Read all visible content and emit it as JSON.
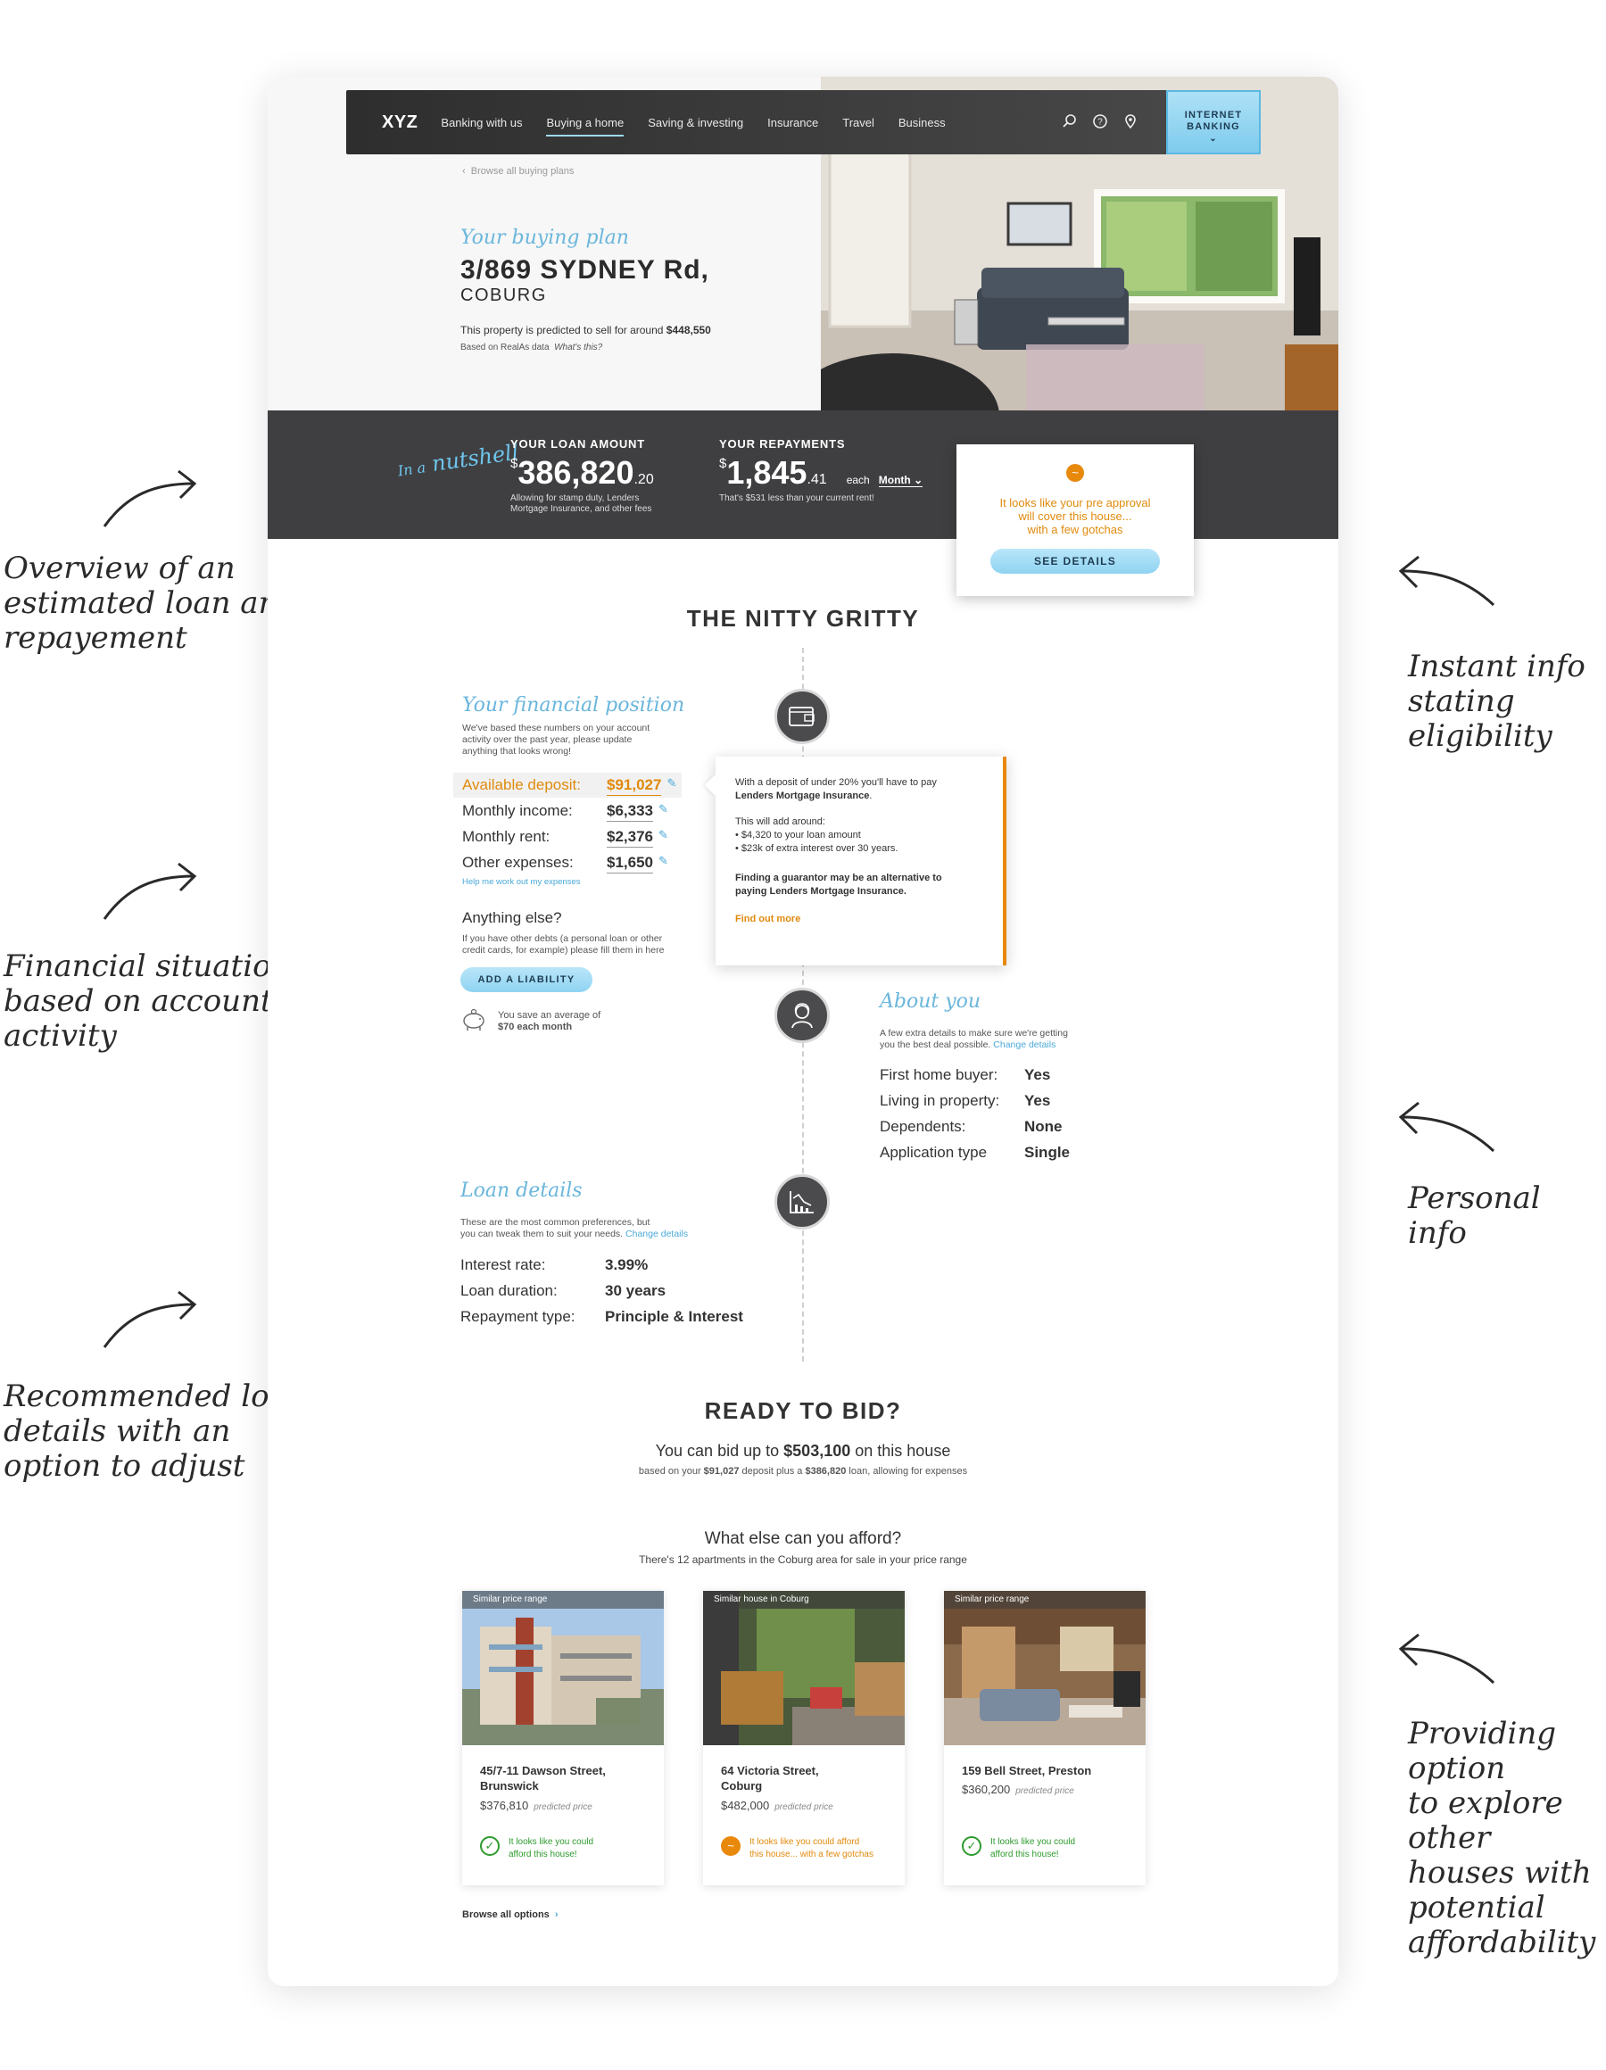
{
  "annotations": {
    "overview": [
      "Overview of an",
      "estimated loan and",
      "repayement"
    ],
    "eligibility": [
      "Instant info",
      "stating",
      "eligibility"
    ],
    "financial": [
      "Financial situation",
      "based on account",
      "activity"
    ],
    "personal": [
      "Personal info"
    ],
    "loan": [
      "Recommended loan",
      "details with an",
      "option to adjust"
    ],
    "explore": [
      "Providing option",
      "to explore other",
      "houses with",
      "potential",
      "affordability"
    ]
  },
  "nav": {
    "logo": "XYZ",
    "items": [
      "Banking with us",
      "Buying a home",
      "Saving & investing",
      "Insurance",
      "Travel",
      "Business"
    ],
    "active_index": 1,
    "icons": [
      "search-icon",
      "help-icon",
      "location-pin-icon"
    ],
    "internet_banking": [
      "INTERNET",
      "BANKING"
    ]
  },
  "hero": {
    "breadcrumb": "Browse all buying plans",
    "kicker": "Your buying plan",
    "title": "3/869 SYDNEY Rd,",
    "suburb": "COBURG",
    "predicted_text": "This property is predicted to sell for around",
    "predicted_value": "$448,550",
    "based_on": "Based on RealAs data",
    "whats_this": "What's this?"
  },
  "nutshell": {
    "label_line1": "In a",
    "label_line2": "nutshell",
    "loan": {
      "heading": "YOUR LOAN AMOUNT",
      "currency": "$",
      "whole": "386,820",
      "cents": ".20",
      "note": [
        "Allowing for stamp duty, Lenders",
        "Mortgage Insurance, and other fees"
      ]
    },
    "repay": {
      "heading": "YOUR REPAYMENTS",
      "currency": "$",
      "whole": "1,845",
      "cents": ".41",
      "each": "each",
      "period": "Month",
      "note": "That's $531 less than your current rent!"
    }
  },
  "preapproval": {
    "lines": [
      "It looks like your pre approval",
      "will cover this house...",
      "with a few gotchas"
    ],
    "button": "SEE DETAILS"
  },
  "nitty": {
    "title": "THE NITTY GRITTY",
    "financial": {
      "title": "Your financial position",
      "desc": [
        "We've based these numbers on your account",
        "activity over the past year, please update",
        "anything that looks wrong!"
      ],
      "rows": [
        {
          "label": "Available deposit:",
          "value": "$91,027"
        },
        {
          "label": "Monthly income:",
          "value": "$6,333"
        },
        {
          "label": "Monthly rent:",
          "value": "$2,376"
        },
        {
          "label": "Other expenses:",
          "value": "$1,650"
        }
      ],
      "help_link": "Help me work out my expenses",
      "anything_else": "Anything else?",
      "anything_desc": [
        "If you have other debts (a personal loan or other",
        "credit cards, for example) please fill them in here"
      ],
      "add_button": "ADD A LIABILITY",
      "savings_line1": "You save an average of",
      "savings_line2": "$70 each month"
    },
    "popover": {
      "intro": "With a deposit of under 20% you'll have to pay",
      "lmi": "Lenders Mortgage Insurance",
      "add_around": "This will add around:",
      "bullets": [
        "$4,320 to your loan amount",
        "$23k of extra interest over 30 years."
      ],
      "guarantor": [
        "Finding a guarantor may be an alternative to",
        "paying Lenders Mortgage Insurance."
      ],
      "find_out": "Find out more"
    },
    "about": {
      "title": "About you",
      "desc1": "A few extra details to make sure we're getting",
      "desc2": "you the best deal possible.",
      "change": "Change details",
      "rows": [
        {
          "label": "First home buyer:",
          "value": "Yes"
        },
        {
          "label": "Living in property:",
          "value": "Yes"
        },
        {
          "label": "Dependents:",
          "value": "None"
        },
        {
          "label": "Application type",
          "value": "Single"
        }
      ]
    },
    "loan": {
      "title": "Loan details",
      "desc1": "These are the most common preferences, but",
      "desc2": "you can tweak them to suit your needs.",
      "change": "Change details",
      "rows": [
        {
          "label": "Interest rate:",
          "value": "3.99%"
        },
        {
          "label": "Loan duration:",
          "value": "30 years"
        },
        {
          "label": "Repayment type:",
          "value": "Principle & Interest"
        }
      ]
    }
  },
  "ready": {
    "title": "READY TO BID?",
    "line_pre": "You can bid up to",
    "amount": "$503,100",
    "line_post": "on this house",
    "small_pre": "based on your",
    "small_deposit": "$91,027",
    "small_mid": "deposit plus a",
    "small_loan": "$386,820",
    "small_post": "loan, allowing for expenses"
  },
  "afford": {
    "title": "What else can you afford?",
    "subtitle": "There's 12 apartments in the Coburg area for sale in your price range",
    "cards": [
      {
        "tag": "Similar price range",
        "addr": [
          "45/7-11 Dawson Street,",
          "Brunswick"
        ],
        "price": "$376,810",
        "price_note": "predicted price",
        "status": "ok",
        "msg": [
          "It looks like you could",
          "afford this house!"
        ]
      },
      {
        "tag": "Similar house in Coburg",
        "addr": [
          "64 Victoria Street,",
          "Coburg"
        ],
        "price": "$482,000",
        "price_note": "predicted price",
        "status": "warn",
        "msg": [
          "It looks like you could afford",
          "this house... with a few gotchas"
        ]
      },
      {
        "tag": "Similar price range",
        "addr": [
          "159 Bell Street, Preston"
        ],
        "price": "$360,200",
        "price_note": "predicted price",
        "status": "ok",
        "msg": [
          "It looks like you could",
          "afford this house!"
        ]
      }
    ],
    "browse": "Browse all options"
  },
  "colors": {
    "accent_blue": "#6ab6dc",
    "button_blue": "#8fd3f1",
    "warning_orange": "#e8890c",
    "success_green": "#2d9a2d",
    "dark_band": "#3f3f41"
  }
}
